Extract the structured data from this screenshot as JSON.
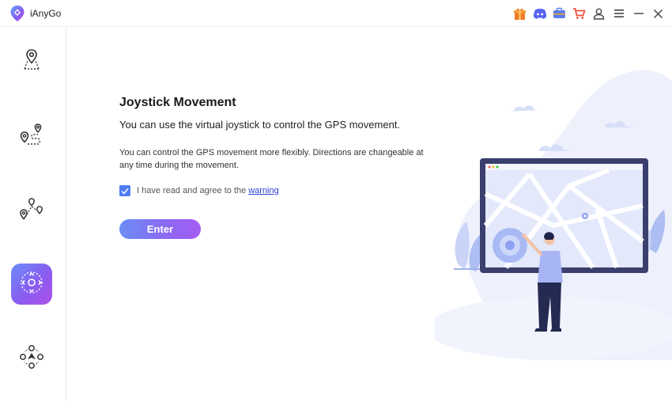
{
  "app": {
    "title": "iAnyGo",
    "brand_gradient": [
      "#6a8cf8",
      "#b051e8"
    ]
  },
  "titlebar_icons": [
    "gift-icon",
    "discord-icon",
    "toolbox-icon",
    "cart-icon",
    "user-icon",
    "menu-icon",
    "minimize-icon",
    "close-icon"
  ],
  "sidebar": {
    "items": [
      {
        "name": "teleport-mode",
        "icon": "single-location-pin-icon",
        "active": false
      },
      {
        "name": "two-spot-mode",
        "icon": "two-spot-route-icon",
        "active": false
      },
      {
        "name": "multi-spot-mode",
        "icon": "multi-spot-route-icon",
        "active": false
      },
      {
        "name": "joystick-mode",
        "icon": "joystick-icon",
        "active": true
      },
      {
        "name": "more-mode",
        "icon": "joystick-arrows-icon",
        "active": false
      }
    ]
  },
  "main": {
    "heading": "Joystick Movement",
    "subheading": "You can use the virtual joystick to control the GPS movement.",
    "description": "You can control the GPS movement more flexibly. Directions are changeable at any time during the movement.",
    "agree_text": "I have read and agree to the",
    "warning_link": "warning",
    "agree_checked": true,
    "enter_label": "Enter"
  }
}
